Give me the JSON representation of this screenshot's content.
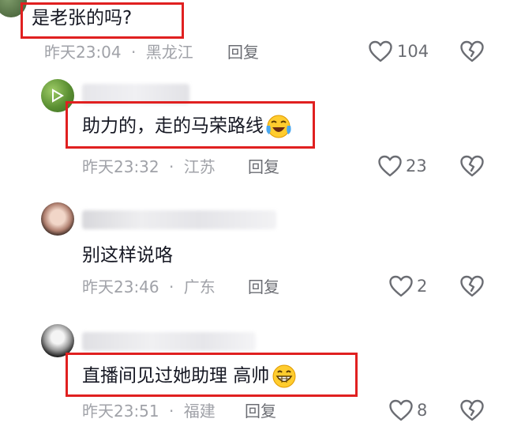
{
  "comments": [
    {
      "text": "是老张的吗?",
      "time": "昨天23:04",
      "location": "黑龙江",
      "reply_label": "回复",
      "like_count": "104"
    },
    {
      "text": "助力的，走的马荣路线",
      "time": "昨天23:32",
      "location": "江苏",
      "reply_label": "回复",
      "like_count": "23",
      "emoji": "laughing-crying-emoji"
    },
    {
      "text": "别这样说咯",
      "time": "昨天23:46",
      "location": "广东",
      "reply_label": "回复",
      "like_count": "2"
    },
    {
      "text": "直播间见过她助理 高帅",
      "time": "昨天23:51",
      "location": "福建",
      "reply_label": "回复",
      "like_count": "8",
      "emoji": "grinning-emoji"
    }
  ],
  "separator": "·",
  "colors": {
    "highlight_box": "#e02020",
    "primary_text": "#161823",
    "secondary_text": "#a0a2a8",
    "icon": "#6b6d73"
  },
  "icons": [
    "heart-outline-icon",
    "broken-heart-icon"
  ]
}
